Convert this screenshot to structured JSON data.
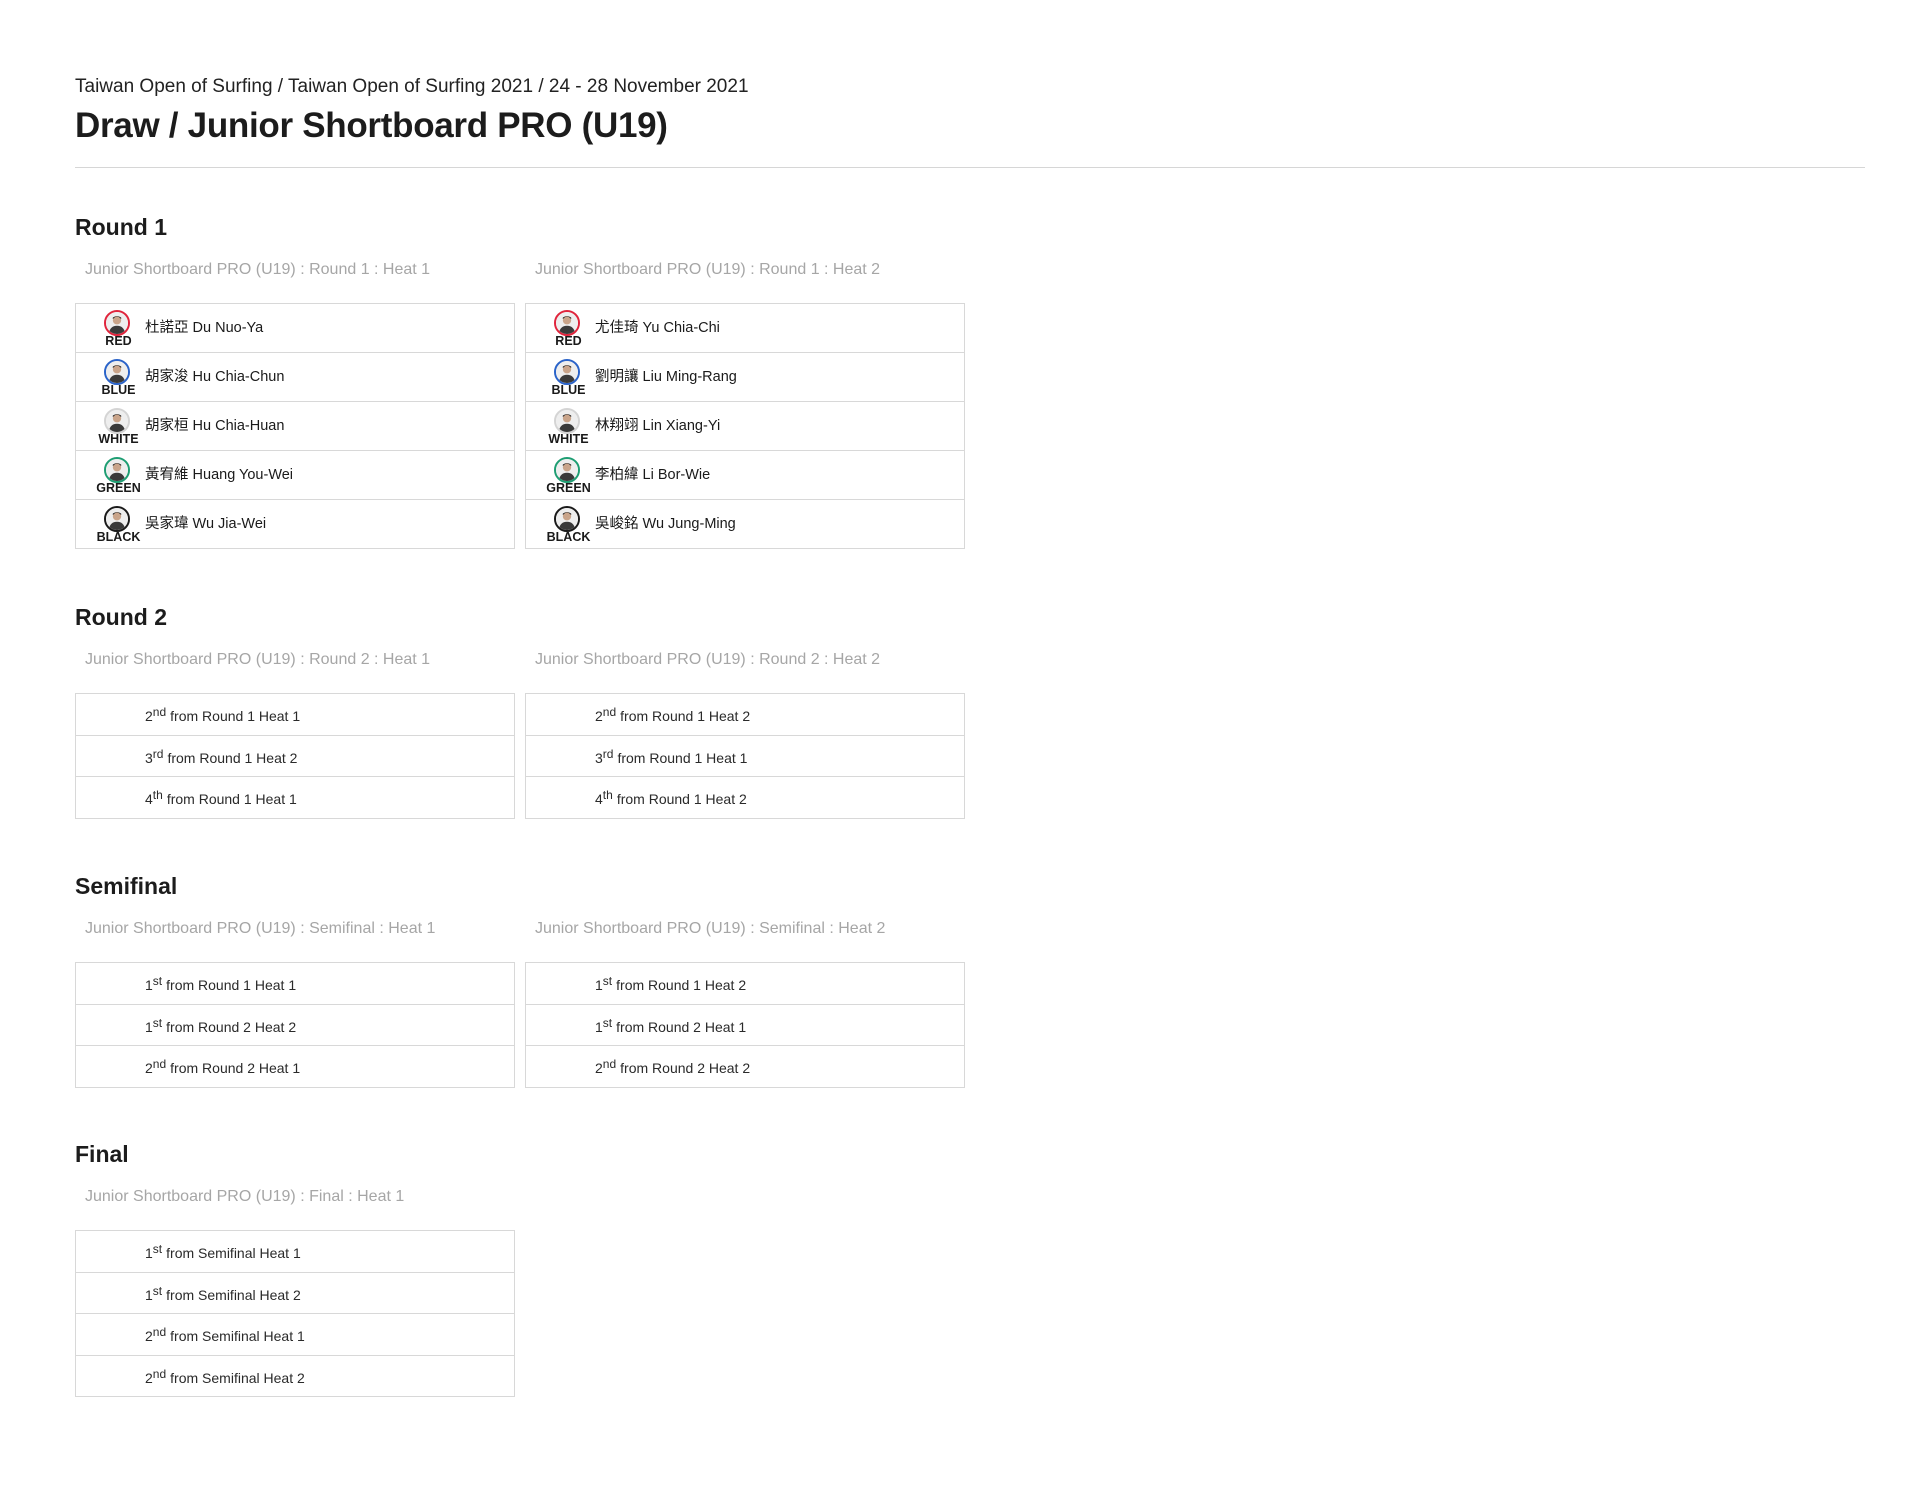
{
  "header": {
    "breadcrumb": "Taiwan Open of Surfing / Taiwan Open of Surfing 2021 / 24 - 28 November 2021",
    "title": "Draw / Junior Shortboard PRO (U19)"
  },
  "jersey_colors": {
    "RED": "#e0243c",
    "BLUE": "#2a63c9",
    "WHITE": "#d4d4d4",
    "GREEN": "#1e9e73",
    "BLACK": "#1a1a1a"
  },
  "rounds": [
    {
      "title": "Round 1",
      "heats": [
        {
          "title": "Junior Shortboard PRO (U19) : Round 1 : Heat 1",
          "surfers": [
            {
              "jersey": "RED",
              "name": "杜諾亞 Du Nuo-Ya",
              "icon": "surfer-avatar-icon"
            },
            {
              "jersey": "BLUE",
              "name": "胡家浚 Hu Chia-Chun",
              "icon": "surfer-avatar-icon"
            },
            {
              "jersey": "WHITE",
              "name": "胡家桓 Hu Chia-Huan",
              "icon": "surfer-avatar-icon"
            },
            {
              "jersey": "GREEN",
              "name": "黃宥維 Huang You-Wei",
              "icon": "surfer-avatar-icon"
            },
            {
              "jersey": "BLACK",
              "name": "吳家瑋 Wu Jia-Wei",
              "icon": "surfer-avatar-icon"
            }
          ]
        },
        {
          "title": "Junior Shortboard PRO (U19) : Round 1 : Heat 2",
          "surfers": [
            {
              "jersey": "RED",
              "name": "尤佳琦 Yu Chia-Chi",
              "icon": "surfer-avatar-icon"
            },
            {
              "jersey": "BLUE",
              "name": "劉明讓 Liu Ming-Rang",
              "icon": "surfer-avatar-icon"
            },
            {
              "jersey": "WHITE",
              "name": "林翔翊 Lin Xiang-Yi",
              "icon": "surfer-avatar-icon"
            },
            {
              "jersey": "GREEN",
              "name": "李柏緯 Li Bor-Wie",
              "icon": "surfer-avatar-icon"
            },
            {
              "jersey": "BLACK",
              "name": "吳峻銘 Wu Jung-Ming",
              "icon": "surfer-avatar-icon"
            }
          ]
        }
      ]
    },
    {
      "title": "Round 2",
      "heats": [
        {
          "title": "Junior Shortboard PRO (U19) : Round 2 : Heat 1",
          "seeds": [
            {
              "num": "2",
              "ord": "nd",
              "text": "from Round 1 Heat 1"
            },
            {
              "num": "3",
              "ord": "rd",
              "text": "from Round 1 Heat 2"
            },
            {
              "num": "4",
              "ord": "th",
              "text": "from Round 1 Heat 1"
            }
          ]
        },
        {
          "title": "Junior Shortboard PRO (U19) : Round 2 : Heat 2",
          "seeds": [
            {
              "num": "2",
              "ord": "nd",
              "text": "from Round 1 Heat 2"
            },
            {
              "num": "3",
              "ord": "rd",
              "text": "from Round 1 Heat 1"
            },
            {
              "num": "4",
              "ord": "th",
              "text": "from Round 1 Heat 2"
            }
          ]
        }
      ]
    },
    {
      "title": "Semifinal",
      "heats": [
        {
          "title": "Junior Shortboard PRO (U19) : Semifinal : Heat 1",
          "seeds": [
            {
              "num": "1",
              "ord": "st",
              "text": "from Round 1 Heat 1"
            },
            {
              "num": "1",
              "ord": "st",
              "text": "from Round 2 Heat 2"
            },
            {
              "num": "2",
              "ord": "nd",
              "text": "from Round 2 Heat 1"
            }
          ]
        },
        {
          "title": "Junior Shortboard PRO (U19) : Semifinal : Heat 2",
          "seeds": [
            {
              "num": "1",
              "ord": "st",
              "text": "from Round 1 Heat 2"
            },
            {
              "num": "1",
              "ord": "st",
              "text": "from Round 2 Heat 1"
            },
            {
              "num": "2",
              "ord": "nd",
              "text": "from Round 2 Heat 2"
            }
          ]
        }
      ]
    },
    {
      "title": "Final",
      "heats": [
        {
          "title": "Junior Shortboard PRO (U19) : Final : Heat 1",
          "seeds": [
            {
              "num": "1",
              "ord": "st",
              "text": "from Semifinal Heat 1"
            },
            {
              "num": "1",
              "ord": "st",
              "text": "from Semifinal Heat 2"
            },
            {
              "num": "2",
              "ord": "nd",
              "text": "from Semifinal Heat 1"
            },
            {
              "num": "2",
              "ord": "nd",
              "text": "from Semifinal Heat 2"
            }
          ]
        }
      ]
    }
  ]
}
